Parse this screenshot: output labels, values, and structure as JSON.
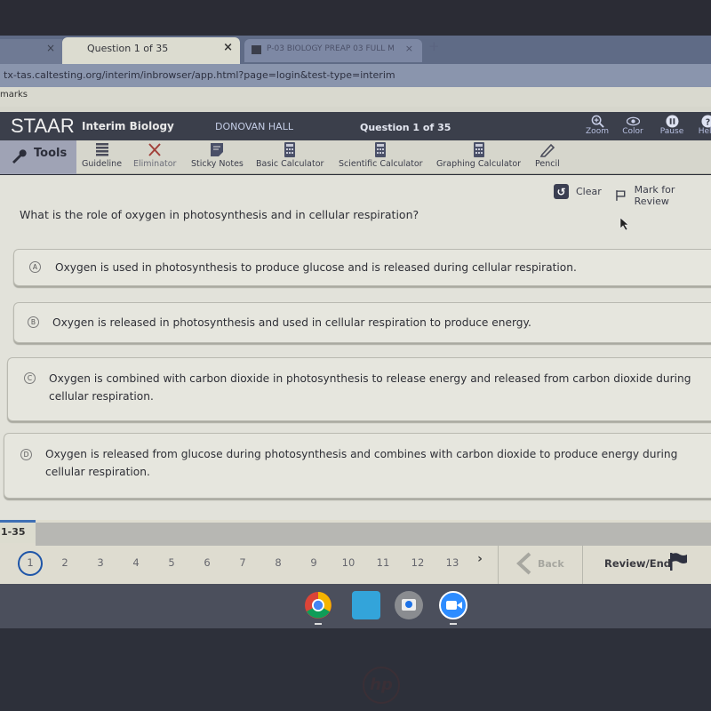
{
  "browser": {
    "tabs": [
      {
        "label": "",
        "active": false
      },
      {
        "label": "Question 1 of 35",
        "active": true
      },
      {
        "label": "P-03 BIOLOGY PREAP 03 FULL M",
        "active": false
      }
    ],
    "close_glyph": "×",
    "new_tab_glyph": "+",
    "url": "tx-tas.caltesting.org/interim/inbrowser/app.html?page=login&test-type=interim",
    "bookmarks_label": "marks"
  },
  "header": {
    "logo": "STAAR",
    "course": "Interim Biology",
    "student": "DONOVAN HALL",
    "question_count": "Question 1 of 35",
    "tools": [
      {
        "label": "Zoom",
        "icon": "zoom-icon"
      },
      {
        "label": "Color",
        "icon": "eye-icon"
      },
      {
        "label": "Pause",
        "icon": "pause-icon"
      },
      {
        "label": "Help",
        "icon": "help-icon"
      }
    ]
  },
  "toolbar": {
    "tools_label": "Tools",
    "items": [
      {
        "label": "Guideline",
        "icon": "guideline-icon"
      },
      {
        "label": "Eliminator",
        "icon": "eliminator-x-icon"
      },
      {
        "label": "Sticky Notes",
        "icon": "sticky-note-icon"
      },
      {
        "label": "Basic Calculator",
        "icon": "calculator-icon"
      },
      {
        "label": "Scientific Calculator",
        "icon": "calculator-icon"
      },
      {
        "label": "Graphing Calculator",
        "icon": "calculator-icon"
      },
      {
        "label": "Pencil",
        "icon": "pencil-icon"
      }
    ]
  },
  "question": {
    "clear_label": "Clear",
    "mark_label": "Mark for Review",
    "prompt": "What is the role of oxygen in photosynthesis and in cellular respiration?",
    "options": [
      {
        "letter": "A",
        "text": "Oxygen is used in photosynthesis to produce glucose and is released during cellular respiration."
      },
      {
        "letter": "B",
        "text": "Oxygen is released in photosynthesis and used in cellular respiration to produce energy."
      },
      {
        "letter": "C",
        "text": "Oxygen is combined with carbon dioxide in photosynthesis to release energy and released from carbon dioxide during cellular respiration."
      },
      {
        "letter": "D",
        "text": "Oxygen is released from glucose during photosynthesis and combines with carbon dioxide to produce energy during cellular respiration."
      }
    ]
  },
  "footer": {
    "range_label": "1-35",
    "numbers": [
      "1",
      "2",
      "3",
      "4",
      "5",
      "6",
      "7",
      "8",
      "9",
      "10",
      "11",
      "12",
      "13"
    ],
    "current": "1",
    "next_glyph": "›",
    "back_label": "Back",
    "review_label": "Review/End"
  },
  "shelf": {
    "apps": [
      "chrome",
      "cloud-app",
      "camera",
      "zoom-meetings"
    ]
  },
  "colors": {
    "header_bg": "#3b3f4b",
    "accent_blue": "#1e55a8",
    "content_bg": "#e2e2da"
  }
}
